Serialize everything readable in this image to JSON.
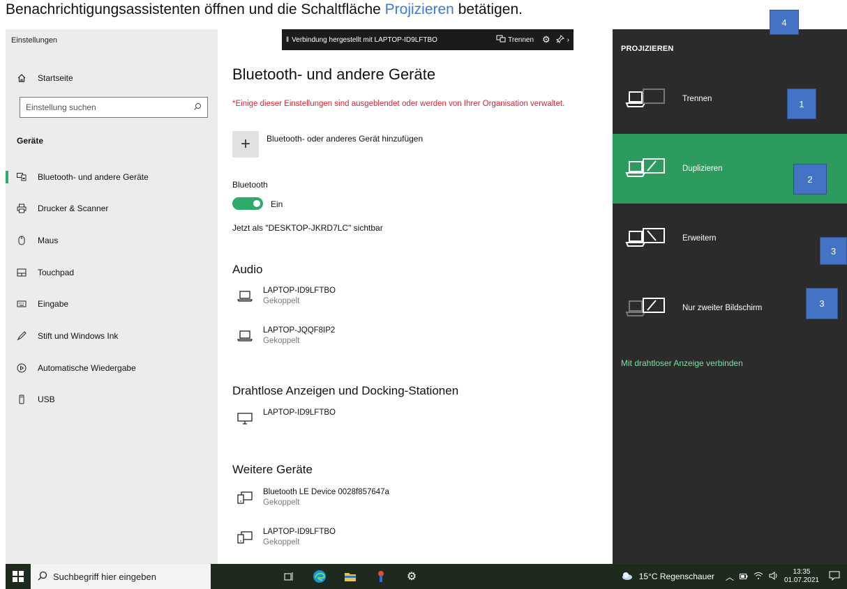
{
  "caption": {
    "pre": "Benachrichtigungsassistenten öffnen und die Schaltfläche ",
    "highlight": "Projizieren",
    "post": " betätigen."
  },
  "sidebar": {
    "title": "Einstellungen",
    "home": "Startseite",
    "search_placeholder": "Einstellung suchen",
    "section": "Geräte",
    "items": [
      {
        "label": "Bluetooth- und andere Geräte",
        "icon": "bluetooth-devices-icon"
      },
      {
        "label": "Drucker & Scanner",
        "icon": "printer-icon"
      },
      {
        "label": "Maus",
        "icon": "mouse-icon"
      },
      {
        "label": "Touchpad",
        "icon": "touchpad-icon"
      },
      {
        "label": "Eingabe",
        "icon": "keyboard-icon"
      },
      {
        "label": "Stift und Windows Ink",
        "icon": "pen-icon"
      },
      {
        "label": "Automatische Wiedergabe",
        "icon": "autoplay-icon"
      },
      {
        "label": "USB",
        "icon": "usb-icon"
      }
    ]
  },
  "connection_bar": {
    "text": "Verbindung hergestellt mit LAPTOP-ID9LFTBO",
    "disconnect": "Trennen"
  },
  "main": {
    "title": "Bluetooth- und andere Geräte",
    "warning": "*Einige dieser Einstellungen sind ausgeblendet oder werden von Ihrer Organisation verwaltet.",
    "add_device": "Bluetooth- oder anderes Gerät hinzufügen",
    "bluetooth_label": "Bluetooth",
    "bluetooth_state": "Ein",
    "visible_as": "Jetzt als \"DESKTOP-JKRD7LC\" sichtbar",
    "audio_heading": "Audio",
    "audio_devices": [
      {
        "name": "LAPTOP-ID9LFTBO",
        "status": "Gekoppelt"
      },
      {
        "name": "LAPTOP-JQQF8IP2",
        "status": "Gekoppelt"
      }
    ],
    "wireless_heading": "Drahtlose Anzeigen und Docking-Stationen",
    "wireless_devices": [
      {
        "name": "LAPTOP-ID9LFTBO"
      }
    ],
    "other_heading": "Weitere Geräte",
    "other_devices": [
      {
        "name": "Bluetooth LE Device 0028f857647a",
        "status": "Gekoppelt"
      },
      {
        "name": "LAPTOP-ID9LFTBO",
        "status": "Gekoppelt"
      }
    ]
  },
  "project_panel": {
    "title": "PROJIZIEREN",
    "options": [
      {
        "label": "Trennen",
        "selected": false
      },
      {
        "label": "Duplizieren",
        "selected": true
      },
      {
        "label": "Erweitern",
        "selected": false
      },
      {
        "label": "Nur zweiter Bildschirm",
        "selected": false
      }
    ],
    "wireless_link": "Mit drahtloser Anzeige verbinden"
  },
  "badges": [
    "4",
    "1",
    "2",
    "3",
    "3"
  ],
  "taskbar": {
    "search_placeholder": "Suchbegriff hier eingeben",
    "weather": "15°C Regenschauer",
    "time": "13:35",
    "date": "01.07.2021"
  },
  "colors": {
    "accent_green": "#2e9b5e",
    "toggle_green": "#2eaa6a",
    "badge_blue": "#4472c4",
    "warning_red": "#dd2233",
    "link_green": "#7fe0a8"
  }
}
